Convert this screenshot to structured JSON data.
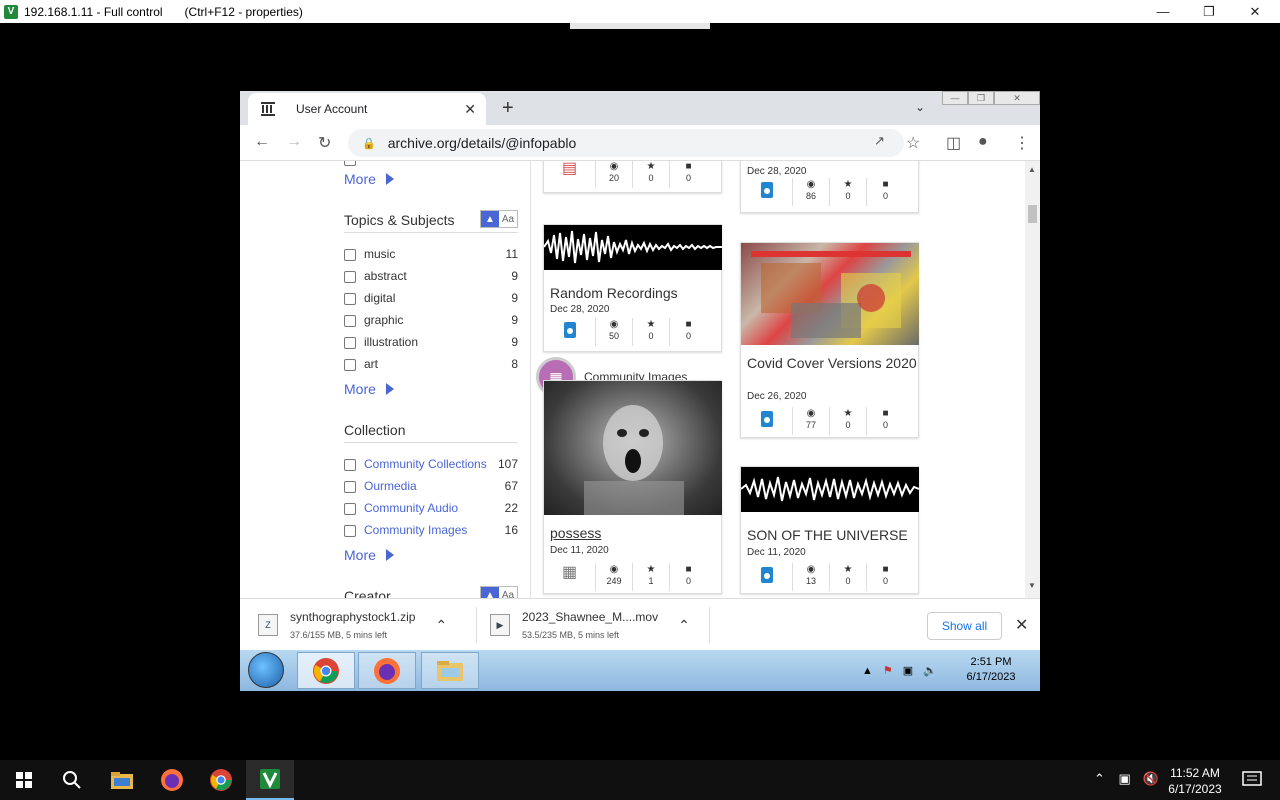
{
  "remote_desktop": {
    "title": "192.168.1.11 - Full control",
    "hint": "(Ctrl+F12 - properties)"
  },
  "browser": {
    "tab_title": "User Account",
    "url": "archive.org/details/@infopablo"
  },
  "sidebar": {
    "more_label": "More",
    "topics": {
      "title": "Topics & Subjects",
      "items": [
        {
          "label": "music",
          "count": "11"
        },
        {
          "label": "abstract",
          "count": "9"
        },
        {
          "label": "digital",
          "count": "9"
        },
        {
          "label": "graphic",
          "count": "9"
        },
        {
          "label": "illustration",
          "count": "9"
        },
        {
          "label": "art",
          "count": "8"
        }
      ]
    },
    "collection": {
      "title": "Collection",
      "items": [
        {
          "label": "Community Collections",
          "count": "107"
        },
        {
          "label": "Ourmedia",
          "count": "67"
        },
        {
          "label": "Community Audio",
          "count": "22"
        },
        {
          "label": "Community Images",
          "count": "16"
        }
      ]
    },
    "next_title": "Creator",
    "toggle_text": "Aa"
  },
  "cards": [
    {
      "title": "",
      "date": "",
      "views": "20",
      "favs": "0",
      "comments": "0",
      "type": "movie"
    },
    {
      "title": "",
      "date": "Dec 28, 2020",
      "views": "86",
      "favs": "0",
      "comments": "0",
      "type": "audio"
    },
    {
      "title": "Random Recordings",
      "date": "Dec 28, 2020",
      "views": "50",
      "favs": "0",
      "comments": "0",
      "type": "audio"
    },
    {
      "title": "Covid Cover Versions 2020",
      "date": "Dec 26, 2020",
      "views": "77",
      "favs": "0",
      "comments": "0",
      "type": "audio"
    },
    {
      "title": "possess",
      "date": "Dec 11, 2020",
      "views": "249",
      "favs": "1",
      "comments": "0",
      "type": "image"
    },
    {
      "title": "SON OF THE UNIVERSE",
      "date": "Dec 11, 2020",
      "views": "13",
      "favs": "0",
      "comments": "0",
      "type": "audio"
    }
  ],
  "community_label": "Community Images",
  "downloads": [
    {
      "name": "synthographystock1.zip",
      "status": "37.6/155 MB, 5 mins left"
    },
    {
      "name": "2023_Shawnee_M....mov",
      "status": "53.5/235 MB, 5 mins left"
    }
  ],
  "show_all": "Show all",
  "remote_clock": {
    "time": "2:51 PM",
    "date": "6/17/2023"
  },
  "host_clock": {
    "time": "11:52 AM",
    "date": "6/17/2023"
  },
  "colors": {
    "link": "#4a65d4",
    "audio": "#2185d0",
    "community": "#b86db5"
  }
}
